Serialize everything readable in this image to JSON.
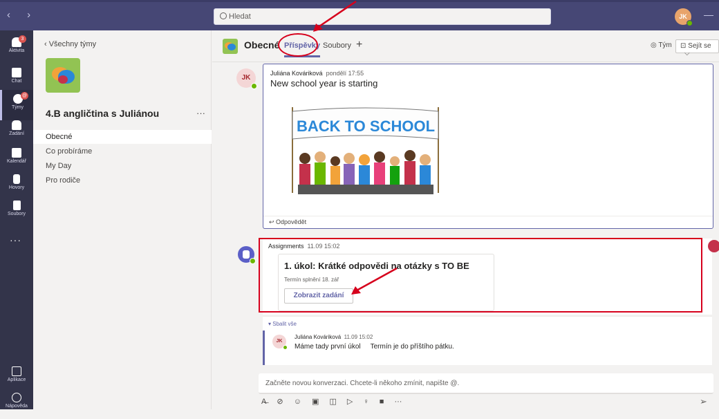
{
  "topbar": {
    "search_placeholder": "Hledat",
    "user_initials": "JK",
    "minimize": "—",
    "nav_arrows": "‹ ›"
  },
  "rail": {
    "items": [
      {
        "label": "Aktivita",
        "icon": "bell-icon",
        "badge": "3"
      },
      {
        "label": "Chat",
        "icon": "chat-icon"
      },
      {
        "label": "Týmy",
        "icon": "teams-icon",
        "badge": "@",
        "active": true
      },
      {
        "label": "Zadání",
        "icon": "assignments-icon"
      },
      {
        "label": "Kalendář",
        "icon": "calendar-icon"
      },
      {
        "label": "Hovory",
        "icon": "phone-icon"
      },
      {
        "label": "Soubory",
        "icon": "files-icon"
      }
    ],
    "more": "···",
    "bottom": [
      {
        "label": "Aplikace",
        "icon": "apps-icon"
      },
      {
        "label": "Nápověda",
        "icon": "help-icon"
      }
    ]
  },
  "teamcol": {
    "back_label": "‹  Všechny týmy",
    "team_name": "4.B angličtina s Juliánou",
    "more": "···",
    "channels": [
      "Obecné",
      "Co probíráme",
      "My Day",
      "Pro rodiče"
    ]
  },
  "channel_header": {
    "title": "Obecné",
    "tabs": [
      "Příspěvky",
      "Soubory"
    ],
    "add_tab": "+",
    "team_btn": "Tým",
    "meet_btn": "Sejít se"
  },
  "post1": {
    "initials": "JK",
    "author": "Juliána Kováriková",
    "time": "pondělí 17:55",
    "title": "New school year is starting",
    "image_text": "BACK TO SCHOOL",
    "reply": "Odpovědět"
  },
  "post2": {
    "author": "Assignments",
    "time": "11.09 15:02",
    "card_title": "1. úkol: Krátké odpovědi na otázky s TO BE",
    "due": "Termín splnění 18. zář",
    "button": "Zobrazit zadání"
  },
  "thread": {
    "collapse": "Sbalit vše",
    "initials": "JK",
    "author": "Juliána Kováriková",
    "time": "11.09 15:02",
    "text1": "Máme tady první úkol",
    "text2": "Termín je do příštího pátku."
  },
  "composer": {
    "placeholder": "Začněte novou konverzaci. Chcete-li někoho zmínit, napište @."
  },
  "colors": {
    "brand": "#6264a7",
    "topbar": "#464775",
    "rail": "#33344a",
    "annotation_red": "#d6001c"
  }
}
